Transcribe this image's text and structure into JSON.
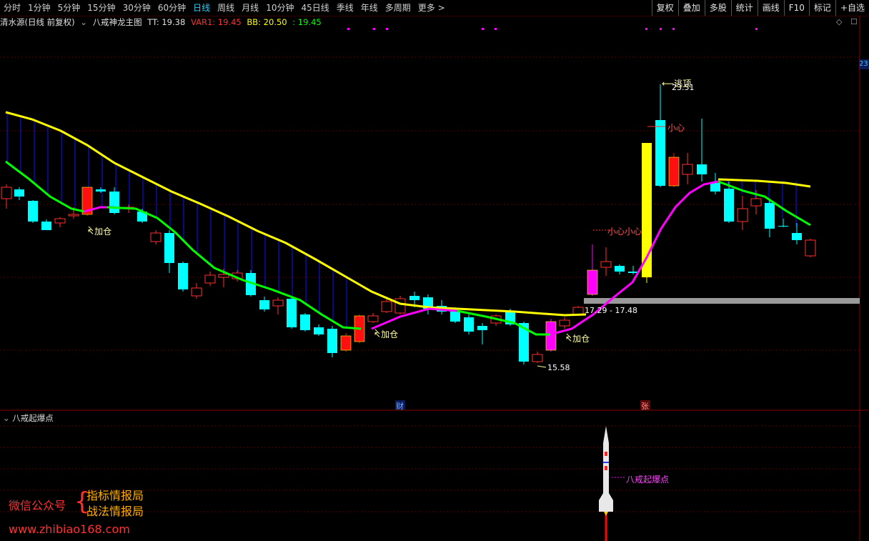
{
  "toolbar": {
    "periods": [
      "分时",
      "1分钟",
      "5分钟",
      "15分钟",
      "30分钟",
      "60分钟",
      "日线",
      "周线",
      "月线",
      "10分钟",
      "45日线",
      "季线",
      "年线",
      "多周期",
      "更多 >"
    ],
    "active_period": "日线",
    "right_buttons": [
      "复权",
      "叠加",
      "多股",
      "统计",
      "画线",
      "F10",
      "标记",
      "+自选"
    ]
  },
  "legend": {
    "stock": "清水源(日线 前复权)",
    "indicator": "八戒神龙主图",
    "tt": "TT: 19.38",
    "var1": "VAR1: 19.45",
    "bb": "BB: 20.50",
    "bb2": ": 19.45"
  },
  "right_tag": "23",
  "labels": {
    "jiacang": "加仓",
    "taoding": "逃顶",
    "high_price": "23.51",
    "xiaoxin": "小心",
    "xiaoxin2": "小心小心",
    "band": "17.29 - 17.48",
    "low_price": "15.58",
    "cai": "财",
    "zhang": "张"
  },
  "sub_panel": {
    "title": "八戒起爆点",
    "rocket_label": "八戒起爆点"
  },
  "watermark": {
    "left": "微信公众号",
    "line1": "指标情报局",
    "line2": "战法情报局",
    "url": "www.zhibiao168.com"
  },
  "colors": {
    "up": "#ff3030",
    "down": "#00ffff",
    "yellow": "#ffff00",
    "green": "#00ff00",
    "magenta": "#ff00ff",
    "blue": "#0000ff",
    "gray": "#999999"
  }
}
